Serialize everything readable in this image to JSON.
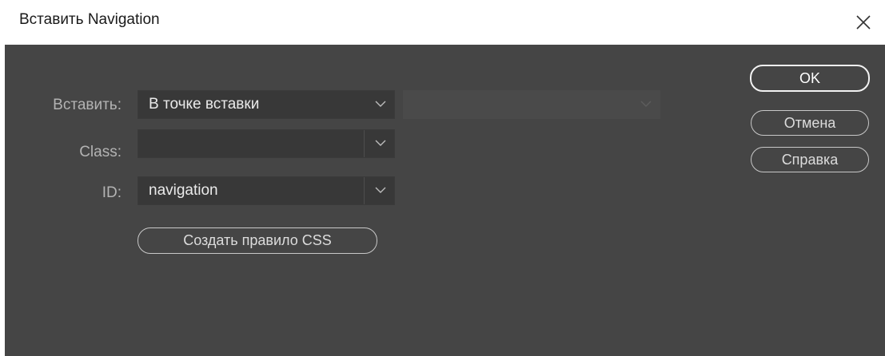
{
  "window": {
    "title": "Вставить Navigation",
    "close_icon": "close-icon"
  },
  "form": {
    "insert": {
      "label": "Вставить:",
      "value": "В точке вставки",
      "secondary_value": ""
    },
    "class": {
      "label": "Class:",
      "value": ""
    },
    "id": {
      "label": "ID:",
      "value": "navigation"
    },
    "create_css_rule_label": "Создать правило CSS"
  },
  "buttons": {
    "ok": "OK",
    "cancel": "Отмена",
    "help": "Справка"
  },
  "colors": {
    "dialog_bg": "#454545",
    "field_bg": "#383838",
    "label_text": "#b3b3b3"
  }
}
